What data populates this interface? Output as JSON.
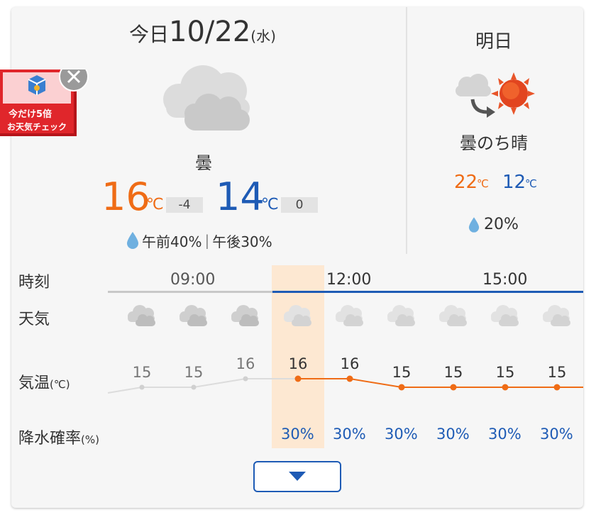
{
  "colors": {
    "accent_orange": "#ef6c16",
    "accent_blue": "#1e5bb5",
    "card_bg": "#f6f6f6",
    "highlight_bg": "#fde8d2",
    "badge_red": "#e0262b"
  },
  "today": {
    "prefix": "今日",
    "date": "10/22",
    "weekday": "(水)",
    "icon": "cloud-icon",
    "condition": "曇",
    "high": "16",
    "high_unit": "℃",
    "high_diff": "-4",
    "low": "14",
    "low_unit": "℃",
    "low_diff": "0",
    "precip_am": "午前40%",
    "precip_sep": "|",
    "precip_pm": "午後30%"
  },
  "tomorrow": {
    "title": "明日",
    "icon": "cloud-then-sun-icon",
    "condition": "曇のち晴",
    "high": "22",
    "high_unit": "℃",
    "low": "12",
    "low_unit": "℃",
    "precip": "20%"
  },
  "hourly": {
    "time_label": "時刻",
    "weather_label": "天気",
    "temp_label": "気温",
    "temp_unit_label": "(℃)",
    "precip_label": "降水確率",
    "precip_unit_label": "(%)",
    "time_ticks": [
      "09:00",
      "12:00",
      "15:00"
    ],
    "temps": [
      "15",
      "15",
      "16",
      "16",
      "16",
      "15",
      "15",
      "15",
      "15"
    ],
    "precip": [
      "30%",
      "30%",
      "30%",
      "30%",
      "30%",
      "30%"
    ],
    "current_index": 3
  },
  "chart_data": {
    "type": "line",
    "x": [
      1,
      2,
      3,
      4,
      5,
      6,
      7,
      8,
      9
    ],
    "series": [
      {
        "values": [
          15,
          15,
          16,
          16,
          16,
          15,
          15,
          15,
          15
        ]
      }
    ],
    "past_count": 4
  },
  "badge": {
    "line1": "今だけ5倍",
    "line2": "お天気チェック",
    "close_icon": "close-icon"
  },
  "expand_button": {
    "icon": "caret-down-icon"
  }
}
